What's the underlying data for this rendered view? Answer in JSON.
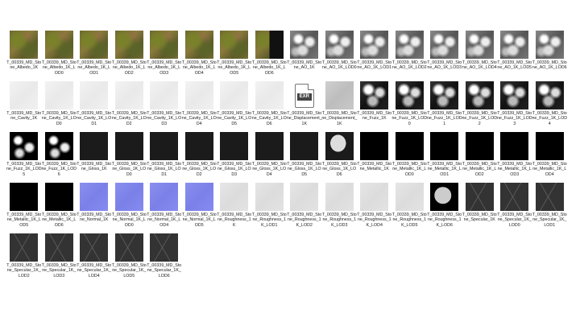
{
  "files": [
    {
      "label": "T_00339_MD_Stone_Albedo_1K",
      "texture": "albedo"
    },
    {
      "label": "T_00339_MD_Stone_Albedo_1K_LOD0",
      "texture": "albedo"
    },
    {
      "label": "T_00339_MD_Stone_Albedo_1K_LOD1",
      "texture": "albedo"
    },
    {
      "label": "T_00339_MD_Stone_Albedo_1K_LOD2",
      "texture": "albedo"
    },
    {
      "label": "T_00339_MD_Stone_Albedo_1K_LOD3",
      "texture": "albedo"
    },
    {
      "label": "T_00339_MD_Stone_Albedo_1K_LOD4",
      "texture": "albedo"
    },
    {
      "label": "T_00339_MD_Stone_Albedo_1K_LOD5",
      "texture": "albedo"
    },
    {
      "label": "T_00339_MD_Stone_Albedo_1K_LOD6",
      "texture": "albedo-mix"
    },
    {
      "label": "T_00339_MD_Stone_AO_1K",
      "texture": "ao"
    },
    {
      "label": "T_00339_MD_Stone_AO_1K_LOD0",
      "texture": "ao"
    },
    {
      "label": "T_00339_MD_Stone_AO_1K_LOD1",
      "texture": "ao"
    },
    {
      "label": "T_00339_MD_Stone_AO_1K_LOD2",
      "texture": "ao"
    },
    {
      "label": "T_00339_MD_Stone_AO_1K_LOD3",
      "texture": "ao"
    },
    {
      "label": "T_00339_MD_Stone_AO_1K_LOD4",
      "texture": "ao"
    },
    {
      "label": "T_00339_MD_Stone_AO_1K_LOD5",
      "texture": "ao"
    },
    {
      "label": "T_00339_MD_Stone_AO_1K_LOD6",
      "texture": "ao"
    },
    {
      "label": "T_00339_MD_Stone_Cavity_1K",
      "texture": "cavity"
    },
    {
      "label": "T_00339_MD_Stone_Cavity_1K_LOD0",
      "texture": "cavity"
    },
    {
      "label": "T_00339_MD_Stone_Cavity_1K_LOD1",
      "texture": "cavity"
    },
    {
      "label": "T_00339_MD_Stone_Cavity_1K_LOD2",
      "texture": "cavity"
    },
    {
      "label": "T_00339_MD_Stone_Cavity_1K_LOD3",
      "texture": "cavity"
    },
    {
      "label": "T_00339_MD_Stone_Cavity_1K_LOD4",
      "texture": "cavity"
    },
    {
      "label": "T_00339_MD_Stone_Cavity_1K_LOD5",
      "texture": "cavity"
    },
    {
      "label": "T_00339_MD_Stone_Cavity_1K_LOD6",
      "texture": "cavity"
    },
    {
      "label": "T_00339_MD_Stone_Displacement_1K",
      "texture": "exr",
      "badge": "EXR"
    },
    {
      "label": "T_00339_MD_Stone_Displacement_1K",
      "texture": "displace"
    },
    {
      "label": "T_00339_MD_Stone_Fuzz_1K",
      "texture": "ao-dark"
    },
    {
      "label": "T_00339_MD_Stone_Fuzz_1K_LOD0",
      "texture": "ao-dark"
    },
    {
      "label": "T_00339_MD_Stone_Fuzz_1K_LOD1",
      "texture": "ao-dark"
    },
    {
      "label": "T_00339_MD_Stone_Fuzz_1K_LOD2",
      "texture": "ao-dark"
    },
    {
      "label": "T_00339_MD_Stone_Fuzz_1K_LOD3",
      "texture": "ao-dark"
    },
    {
      "label": "T_00339_MD_Stone_Fuzz_1K_LOD4",
      "texture": "ao-dark"
    },
    {
      "label": "T_00339_MD_Stone_Fuzz_1K_LOD5",
      "texture": "fuzz"
    },
    {
      "label": "T_00339_MD_Stone_Fuzz_1K_LOD6",
      "texture": "fuzz"
    },
    {
      "label": "T_00339_MD_Stone_Gloss_1K",
      "texture": "gloss"
    },
    {
      "label": "T_00339_MD_Stone_Gloss_1K_LOD0",
      "texture": "gloss"
    },
    {
      "label": "T_00339_MD_Stone_Gloss_1K_LOD1",
      "texture": "gloss"
    },
    {
      "label": "T_00339_MD_Stone_Gloss_1K_LOD2",
      "texture": "gloss"
    },
    {
      "label": "T_00339_MD_Stone_Gloss_1K_LOD3",
      "texture": "gloss"
    },
    {
      "label": "T_00339_MD_Stone_Gloss_1K_LOD4",
      "texture": "gloss"
    },
    {
      "label": "T_00339_MD_Stone_Gloss_1K_LOD5",
      "texture": "gloss"
    },
    {
      "label": "T_00339_MD_Stone_Gloss_1K_LOD6",
      "texture": "gloss-mix"
    },
    {
      "label": "T_00339_MD_Stone_Metallic_1K",
      "texture": "black"
    },
    {
      "label": "T_00339_MD_Stone_Metallic_1K_LOD0",
      "texture": "black"
    },
    {
      "label": "T_00339_MD_Stone_Metallic_1K_LOD1",
      "texture": "black"
    },
    {
      "label": "T_00339_MD_Stone_Metallic_1K_LOD2",
      "texture": "black"
    },
    {
      "label": "T_00339_MD_Stone_Metallic_1K_LOD3",
      "texture": "black"
    },
    {
      "label": "T_00339_MD_Stone_Metallic_1K_LOD4",
      "texture": "black"
    },
    {
      "label": "T_00339_MD_Stone_Metallic_1K_LOD5",
      "texture": "black"
    },
    {
      "label": "T_00339_MD_Stone_Metallic_1K_LOD6",
      "texture": "black"
    },
    {
      "label": "T_00339_MD_Stone_Normal_1K",
      "texture": "normal"
    },
    {
      "label": "T_00339_MD_Stone_Normal_1K_LOD0",
      "texture": "normal"
    },
    {
      "label": "T_00339_MD_Stone_Normal_1K_LOD4",
      "texture": "normal"
    },
    {
      "label": "T_00339_MD_Stone_Normal_1K_LOD5",
      "texture": "normal"
    },
    {
      "label": "T_00339_MD_Stone_Roughness_1K",
      "texture": "rough"
    },
    {
      "label": "T_00339_MD_Stone_Roughness_1K_LOD1",
      "texture": "rough"
    },
    {
      "label": "T_00339_MD_Stone_Roughness_1K_LOD2",
      "texture": "rough"
    },
    {
      "label": "T_00339_MD_Stone_Roughness_1K_LOD3",
      "texture": "rough"
    },
    {
      "label": "T_00339_MD_Stone_Roughness_1K_LOD4",
      "texture": "rough"
    },
    {
      "label": "T_00339_MD_Stone_Roughness_1K_LOD5",
      "texture": "rough"
    },
    {
      "label": "T_00339_MD_Stone_Roughness_1K_LOD6",
      "texture": "metal-mix"
    },
    {
      "label": "T_00339_MD_Stone_Specular_1K",
      "texture": "spec"
    },
    {
      "label": "T_00339_MD_Stone_Specular_1K_LOD0",
      "texture": "spec"
    },
    {
      "label": "T_00339_MD_Stone_Specular_1K_LOD1",
      "texture": "spec"
    },
    {
      "label": "T_00339_MD_Stone_Specular_1K_LOD2",
      "texture": "spec"
    },
    {
      "label": "T_00339_MD_Stone_Specular_1K_LOD3",
      "texture": "spec"
    },
    {
      "label": "T_00339_MD_Stone_Specular_1K_LOD4",
      "texture": "spec"
    },
    {
      "label": "T_00339_MD_Stone_Specular_1K_LOD5",
      "texture": "spec"
    },
    {
      "label": "T_00339_MD_Stone_Specular_1K_LOD6",
      "texture": "spec"
    }
  ]
}
